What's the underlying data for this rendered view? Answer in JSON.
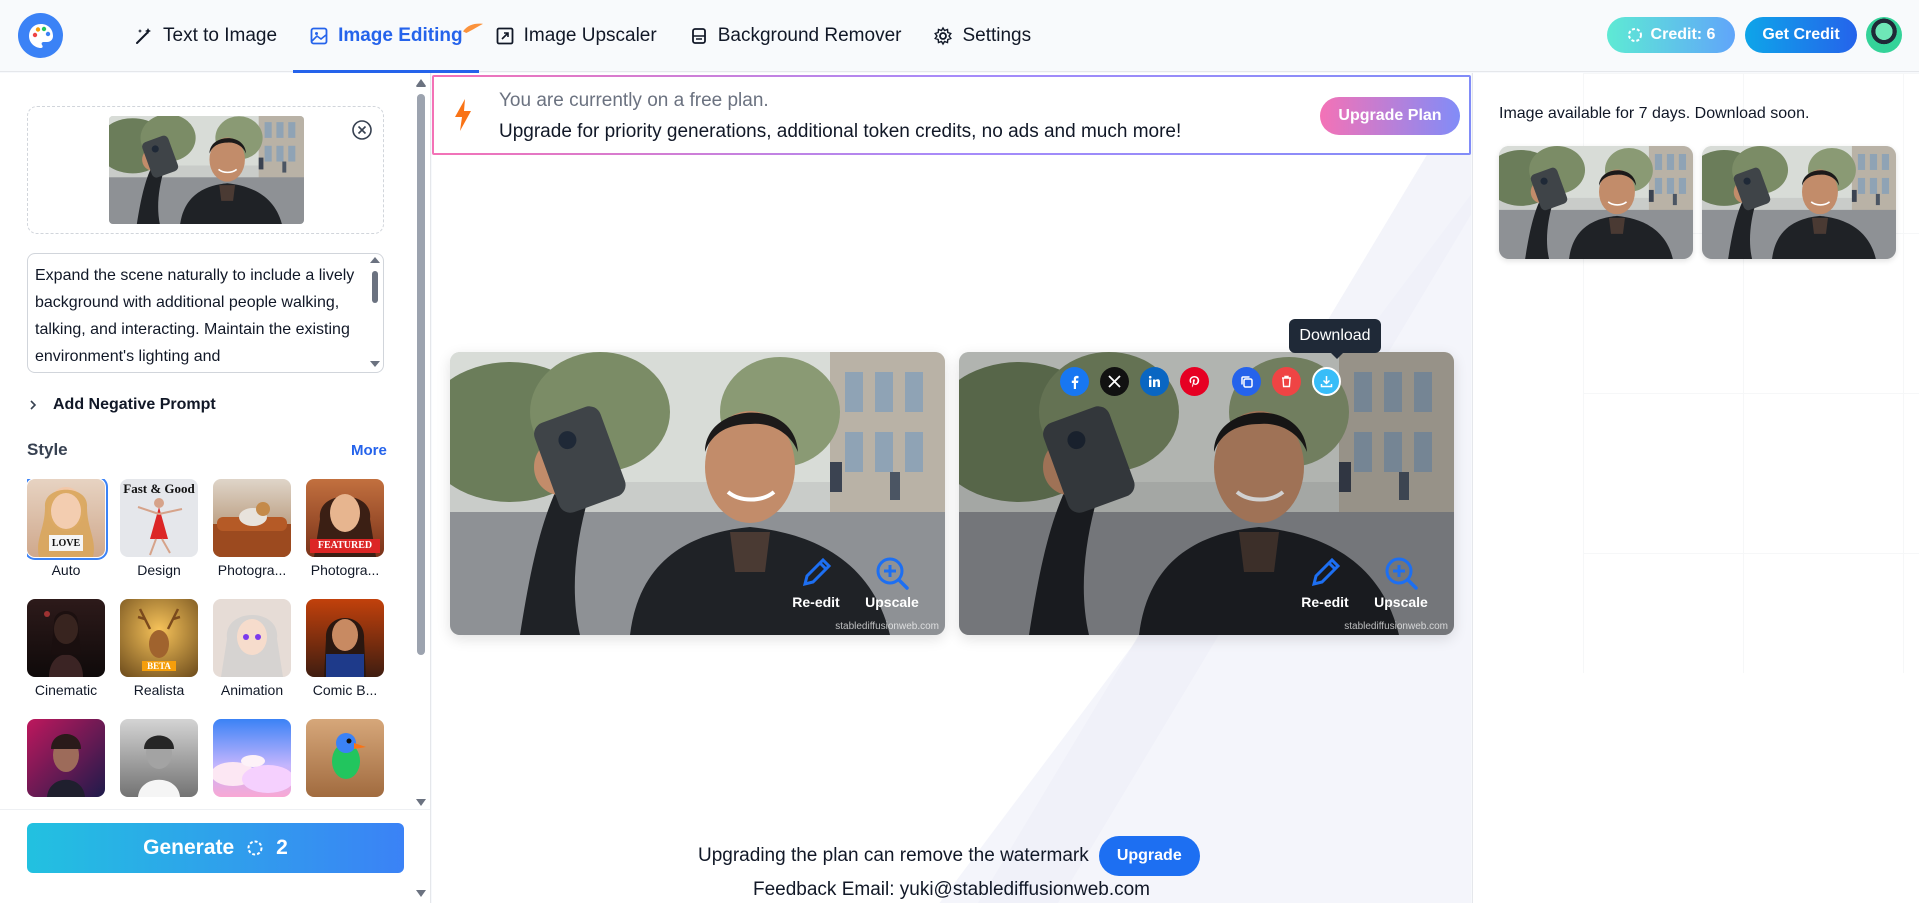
{
  "nav": {
    "tabs": [
      {
        "label": "Text to Image",
        "icon": "magic-wand-icon"
      },
      {
        "label": "Image Editing",
        "icon": "image-icon",
        "active": true
      },
      {
        "label": "Image Upscaler",
        "icon": "expand-icon"
      },
      {
        "label": "Background Remover",
        "icon": "eraser-icon"
      },
      {
        "label": "Settings",
        "icon": "gear-icon"
      }
    ],
    "credit_label": "Credit: 6",
    "get_credit_label": "Get Credit"
  },
  "left_panel": {
    "prompt_text": "Expand the scene naturally to include a lively background with additional people walking, talking, and interacting. Maintain the existing environment's lighting and",
    "negative_prompt_label": "Add Negative Prompt",
    "style_label": "Style",
    "more_label": "More",
    "styles": [
      {
        "name": "Auto",
        "selected": true
      },
      {
        "name": "Design",
        "caption": "Fast & Good"
      },
      {
        "name": "Photogra..."
      },
      {
        "name": "Photogra...",
        "caption": "FEATURED"
      },
      {
        "name": "Cinematic"
      },
      {
        "name": "Realista",
        "caption": "BETA"
      },
      {
        "name": "Animation"
      },
      {
        "name": "Comic B..."
      },
      {
        "name": ""
      },
      {
        "name": ""
      },
      {
        "name": ""
      },
      {
        "name": ""
      }
    ],
    "auto_sign_text": "LOVE",
    "generate_label": "Generate",
    "generate_cost": "2"
  },
  "promo": {
    "line1": "You are currently on a free plan.",
    "line2": "Upgrade for priority generations, additional token credits, no ads and much more!",
    "button": "Upgrade Plan"
  },
  "results": {
    "reedit_label": "Re-edit",
    "upscale_label": "Upscale",
    "watermark": "stablediffusionweb.com",
    "tooltip": "Download",
    "share_icons": [
      "facebook-icon",
      "x-icon",
      "linkedin-icon",
      "pinterest-icon",
      "copy-icon",
      "trash-icon",
      "download-icon"
    ]
  },
  "footer": {
    "watermark_note": "Upgrading the plan can remove the watermark",
    "upgrade_label": "Upgrade",
    "feedback": "Feedback Email: yuki@stablediffusionweb.com"
  },
  "right_panel": {
    "availability_note": "Image available for 7 days. Download soon."
  },
  "colors": {
    "accent": "#2563eb",
    "facebook": "#1877f2",
    "x": "#111111",
    "linkedin": "#0a66c2",
    "pinterest": "#e60023",
    "copy": "#2563eb",
    "trash": "#ef4444",
    "download": "#38bdf8"
  }
}
